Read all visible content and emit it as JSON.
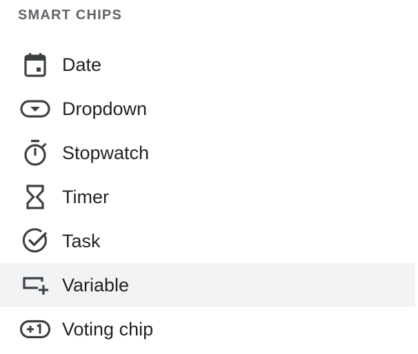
{
  "section": {
    "title": "SMART CHIPS"
  },
  "items": [
    {
      "label": "Date",
      "icon": "calendar-icon",
      "highlighted": false
    },
    {
      "label": "Dropdown",
      "icon": "dropdown-chip-icon",
      "highlighted": false
    },
    {
      "label": "Stopwatch",
      "icon": "stopwatch-icon",
      "highlighted": false
    },
    {
      "label": "Timer",
      "icon": "hourglass-icon",
      "highlighted": false
    },
    {
      "label": "Task",
      "icon": "check-circle-icon",
      "highlighted": false
    },
    {
      "label": "Variable",
      "icon": "variable-add-icon",
      "highlighted": true
    },
    {
      "label": "Voting chip",
      "icon": "plus-one-icon",
      "highlighted": false
    }
  ],
  "colors": {
    "icon": "#3c4043",
    "text": "#202124",
    "header": "#5f6368",
    "hover": "#f1f3f4"
  }
}
